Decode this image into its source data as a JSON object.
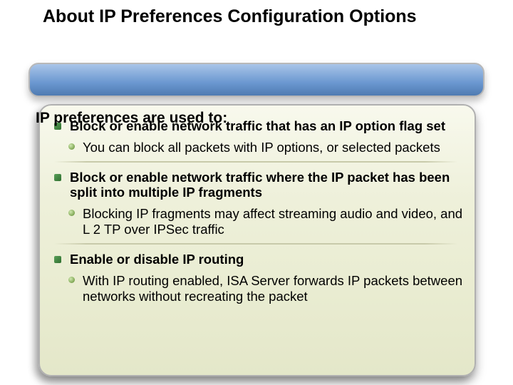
{
  "title": "About IP Preferences Configuration Options",
  "intro": "IP preferences are used to:",
  "bullets": [
    {
      "text": "Block or enable network traffic that has an IP option flag set",
      "sub": "You can block all packets with IP options, or selected packets"
    },
    {
      "text": "Block or enable network traffic where the IP packet has been split into multiple IP fragments",
      "sub": "Blocking IP fragments may affect streaming audio and video, and L 2 TP over IPSec traffic"
    },
    {
      "text": "Enable or disable IP routing",
      "sub": "With IP routing enabled, ISA Server forwards IP packets between networks without recreating the packet"
    }
  ]
}
